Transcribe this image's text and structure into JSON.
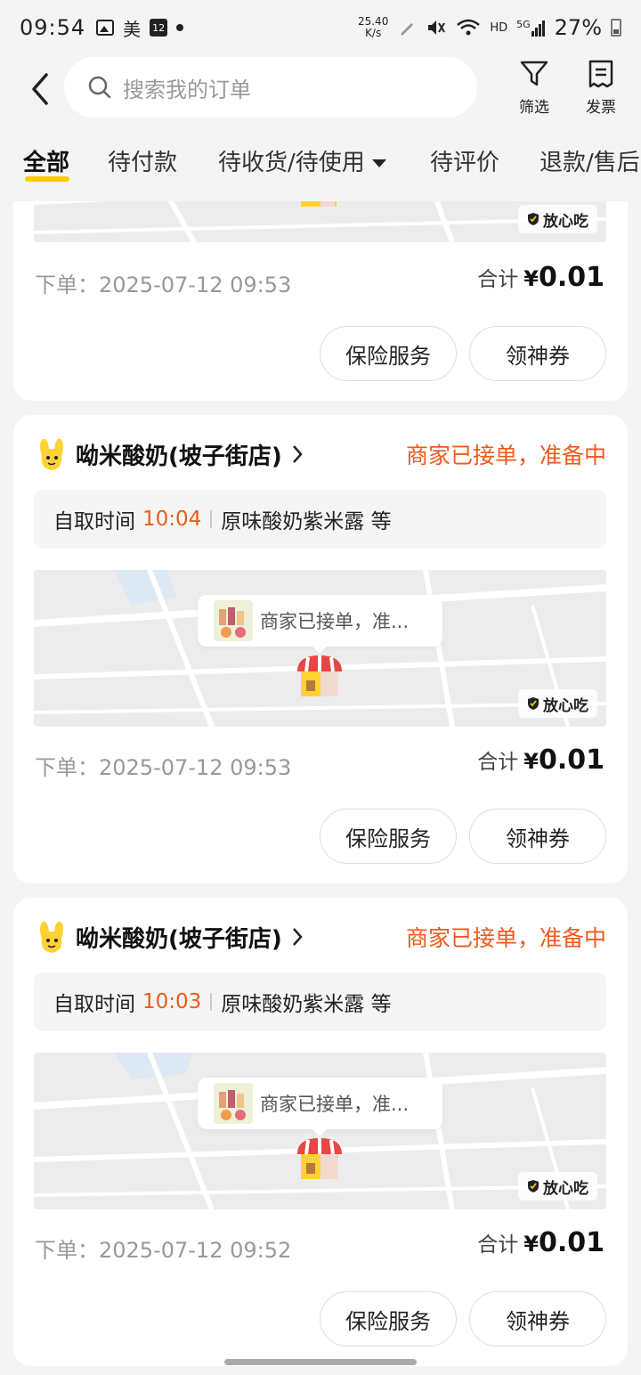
{
  "status_bar": {
    "time": "09:54",
    "mei_label": "美",
    "calendar_day": "12",
    "speed_top": "25.40",
    "speed_bottom": "K/s",
    "hd": "HD",
    "net": "5G",
    "battery": "27%"
  },
  "header": {
    "search_placeholder": "搜索我的订单",
    "filter_label": "筛选",
    "invoice_label": "发票"
  },
  "tabs": [
    {
      "label": "全部",
      "active": true
    },
    {
      "label": "待付款",
      "active": false
    },
    {
      "label": "待收货/待使用",
      "active": false
    },
    {
      "label": "待评价",
      "active": false
    },
    {
      "label": "退款/售后",
      "active": false
    }
  ],
  "cards": [
    {
      "badge": "放心吃",
      "order_time": "下单：2025-07-12 09:53",
      "total_label": "合计",
      "currency": "¥",
      "amount": "0.01",
      "insurance_button": "保险服务",
      "coupon_button": "领神券"
    },
    {
      "shop_name": "呦米酸奶(坡子街店)",
      "status": "商家已接单，准备中",
      "pickup_label": "自取时间",
      "pickup_time": "10:04",
      "items": "原味酸奶紫米露 等",
      "map_bubble": "商家已接单，准...",
      "badge": "放心吃",
      "order_time": "下单：2025-07-12 09:53",
      "total_label": "合计",
      "currency": "¥",
      "amount": "0.01",
      "insurance_button": "保险服务",
      "coupon_button": "领神券"
    },
    {
      "shop_name": "呦米酸奶(坡子街店)",
      "status": "商家已接单，准备中",
      "pickup_label": "自取时间",
      "pickup_time": "10:03",
      "items": "原味酸奶紫米露 等",
      "map_bubble": "商家已接单，准...",
      "badge": "放心吃",
      "order_time": "下单：2025-07-12 09:52",
      "total_label": "合计",
      "currency": "¥",
      "amount": "0.01",
      "insurance_button": "保险服务",
      "coupon_button": "领神券"
    }
  ],
  "colors": {
    "accent_orange": "#f05a1a",
    "tab_underline": "#ffcc00"
  }
}
